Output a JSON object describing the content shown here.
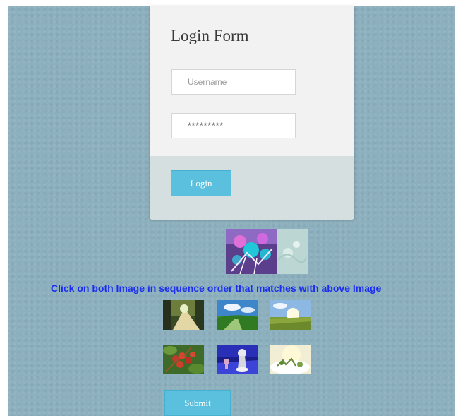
{
  "login": {
    "title": "Login Form",
    "username_placeholder": "Username",
    "password_value": "*********",
    "login_label": "Login"
  },
  "captcha": {
    "instruction": "Click on both Image in sequence order that matches with above Image",
    "submit_label": "Submit",
    "choices": [
      {
        "icon": "forest-road-photo"
      },
      {
        "icon": "green-field-sky-photo"
      },
      {
        "icon": "sunlit-meadow-photo"
      },
      {
        "icon": "red-berries-photo"
      },
      {
        "icon": "chess-pawn-3d-photo"
      },
      {
        "icon": "snowy-tree-photo"
      }
    ]
  },
  "colors": {
    "background": "#8db0be",
    "accent": "#5bc0de",
    "instruction_text": "#1a2df0"
  }
}
